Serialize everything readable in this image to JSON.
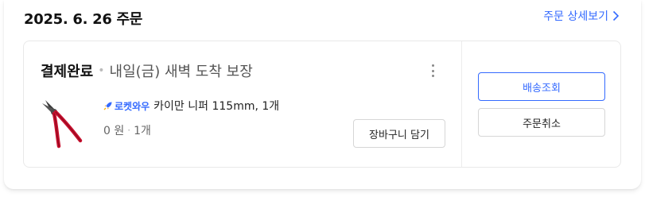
{
  "order": {
    "date": "2025. 6. 26 주문",
    "detail_link_label": "주문 상세보기"
  },
  "status": {
    "main": "결제완료",
    "separator": "•",
    "sub": "내일(금) 새벽 도착 보장"
  },
  "product": {
    "badge_label": "로켓와우",
    "name": "카이만 니퍼 115mm, 1개",
    "price": "0 원",
    "separator": "·",
    "quantity": "1개",
    "icon": "pliers-product-image"
  },
  "buttons": {
    "add_to_cart": "장바구니 담기",
    "track_delivery": "배송조회",
    "cancel_order": "주문취소"
  },
  "colors": {
    "accent": "#346aff",
    "product_handle": "#c8102e"
  }
}
